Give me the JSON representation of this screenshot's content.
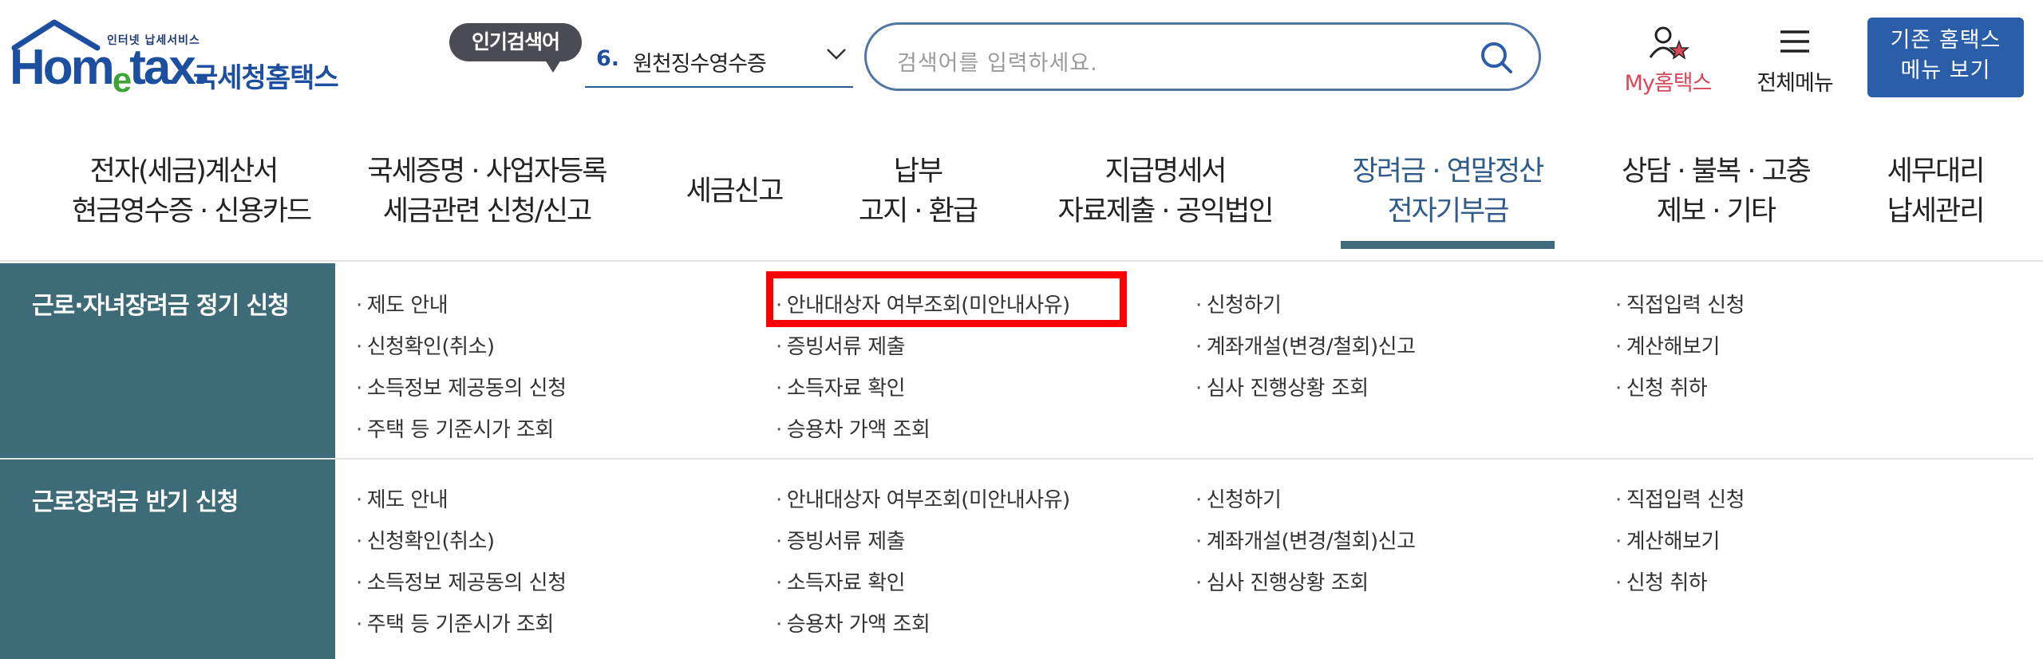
{
  "header": {
    "logo_tagline": "인터넷 납세서비스",
    "logo_text_pre": "Hom",
    "logo_text_e": "e",
    "logo_text_post": "tax.",
    "logo_korean": "국세청홈택스",
    "popular_badge": "인기검색어",
    "popular_num": "6.",
    "popular_text": "원천징수영수증",
    "search_placeholder": "검색어를 입력하세요.",
    "mytax_label": "My홈택스",
    "allmenu_label": "전체메뉴",
    "old_menu_line1": "기존 홈택스",
    "old_menu_line2": "메뉴 보기"
  },
  "gnb": [
    {
      "line1": "전자(세금)계산서",
      "line2": "현금영수증 · 신용카드"
    },
    {
      "line1": "국세증명 · 사업자등록",
      "line2": "세금관련 신청/신고"
    },
    {
      "line1": "세금신고",
      "line2": ""
    },
    {
      "line1": "납부",
      "line2": "고지 · 환급"
    },
    {
      "line1": "지급명세서",
      "line2": "자료제출 · 공익법인"
    },
    {
      "line1": "장려금 · 연말정산",
      "line2": "전자기부금"
    },
    {
      "line1": "상담 · 불복 · 고충",
      "line2": "제보 · 기타"
    },
    {
      "line1": "세무대리",
      "line2": "납세관리"
    }
  ],
  "sections": [
    {
      "title": "근로·자녀장려금 정기 신청",
      "links": [
        "제도 안내",
        "안내대상자 여부조회(미안내사유)",
        "신청하기",
        "직접입력 신청",
        "신청확인(취소)",
        "증빙서류 제출",
        "계좌개설(변경/철회)신고",
        "계산해보기",
        "소득정보 제공동의 신청",
        "소득자료 확인",
        "심사 진행상황 조회",
        "신청 취하",
        "주택 등 기준시가 조회",
        "승용차 가액 조회"
      ]
    },
    {
      "title": "근로장려금 반기 신청",
      "links": [
        "제도 안내",
        "안내대상자 여부조회(미안내사유)",
        "신청하기",
        "직접입력 신청",
        "신청확인(취소)",
        "증빙서류 제출",
        "계좌개설(변경/철회)신고",
        "계산해보기",
        "소득정보 제공동의 신청",
        "소득자료 확인",
        "심사 진행상황 조회",
        "신청 취하",
        "주택 등 기준시가 조회",
        "승용차 가액 조회"
      ]
    }
  ],
  "colors": {
    "brand_blue": "#1d4fa1",
    "brand_green": "#3da535",
    "side_bg": "#3d6b78",
    "highlight": "#ff0000",
    "mytax_red": "#d9475a"
  }
}
